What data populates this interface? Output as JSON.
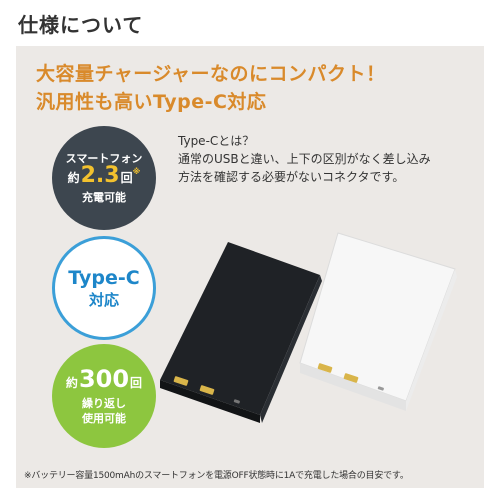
{
  "header": {
    "title": "仕様について"
  },
  "headline": {
    "line1": "大容量チャージャーなのにコンパクト！",
    "line2": "汎用性も高いType-C対応"
  },
  "typec_description": {
    "title": "Type-Cとは？",
    "line1": "通常のUSBと違い、上下の区別がなく差し込み",
    "line2": "方法を確認する必要がないコネクタです。"
  },
  "badges": {
    "charge": {
      "top": "スマートフォン",
      "prefix": "約",
      "value": "2.3",
      "unit": "回",
      "note_mark": "※",
      "bottom": "充電可能"
    },
    "typec": {
      "line1": "Type-C",
      "line2": "対応"
    },
    "cycle": {
      "prefix": "約",
      "value": "300",
      "unit": "回",
      "line2": "繰り返し",
      "line3": "使用可能"
    }
  },
  "products": {
    "black_color": "#1f2226",
    "white_color": "#f7f7f7"
  },
  "footnote": "※バッテリー容量1500mAhのスマートフォンを電源OFF状態時に1Aで充電した場合の目安です。",
  "colors": {
    "accent": "#d98a2b",
    "panel": "#ece9e6",
    "badge_dark": "#3d464f",
    "badge_blue": "#3b9fd8",
    "badge_green": "#8dc63f"
  }
}
